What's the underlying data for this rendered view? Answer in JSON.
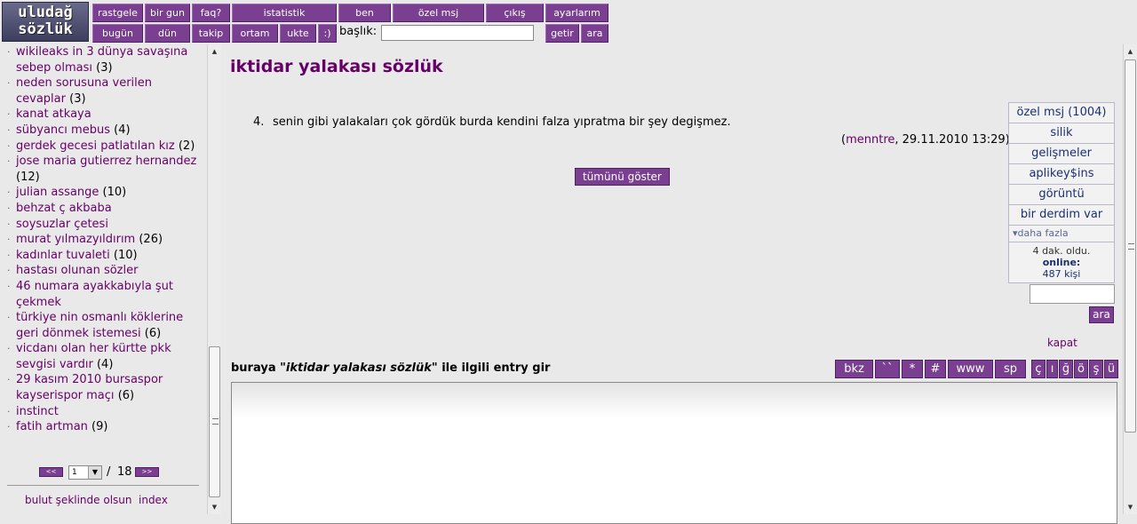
{
  "logo": {
    "line1": "uludağ",
    "line2": "sözlük"
  },
  "nav": {
    "row1": [
      "rastgele",
      "bir gun",
      "faq?",
      "istatistik",
      "ben",
      "özel msj",
      "çıkış",
      "ayarlarım"
    ],
    "row2": [
      "bugün",
      "dün",
      "takip",
      "ortam",
      "ukte",
      ":)"
    ],
    "baslik_label": "başlık:",
    "baslik_value": "",
    "getir": "getir",
    "ara": "ara"
  },
  "sidebar": {
    "topics": [
      {
        "title": "wikileaks in 3 dünya savaşına sebep olması",
        "count": "(3)"
      },
      {
        "title": "neden sorusuna verilen cevaplar",
        "count": "(3)"
      },
      {
        "title": "kanat atkaya",
        "count": ""
      },
      {
        "title": "sübyancı mebus",
        "count": "(4)"
      },
      {
        "title": "gerdek gecesi patlatılan kız",
        "count": "(2)"
      },
      {
        "title": "jose maria gutierrez hernandez",
        "count": "(12)"
      },
      {
        "title": "julian assange",
        "count": "(10)"
      },
      {
        "title": "behzat ç akbaba",
        "count": ""
      },
      {
        "title": "soysuzlar çetesi",
        "count": ""
      },
      {
        "title": "murat yılmazyıldırım",
        "count": "(26)"
      },
      {
        "title": "kadınlar tuvaleti",
        "count": "(10)"
      },
      {
        "title": "hastası olunan sözler",
        "count": ""
      },
      {
        "title": "46 numara ayakkabıyla şut çekmek",
        "count": ""
      },
      {
        "title": "türkiye nin osmanlı köklerine geri dönmek istemesi",
        "count": "(6)"
      },
      {
        "title": "vicdanı olan her kürtte pkk sevgisi vardır",
        "count": "(4)"
      },
      {
        "title": "29 kasım 2010 bursaspor kayserispor maçı",
        "count": "(6)"
      },
      {
        "title": "instinct",
        "count": ""
      },
      {
        "title": "fatih artman",
        "count": "(9)"
      }
    ],
    "pager": {
      "prev": "<<",
      "page": "1",
      "slash": "/",
      "total": "18",
      "next": ">>"
    },
    "bulut": "bulut şeklinde olsun",
    "index": "index"
  },
  "main": {
    "title": "iktidar yalakası sözlük",
    "entry": {
      "number": "4.",
      "text": "senin gibi yalakaları çok gördük burda kendini falza yıpratma bir şey degişmez.",
      "meta_open": "(",
      "author": "menntre",
      "meta_rest": ", 29.11.2010 13:29)"
    },
    "show_all": "tümünü göster",
    "entry_prompt_prefix": "buraya ",
    "entry_prompt_title": "\"iktidar yalakası sözlük\"",
    "entry_prompt_suffix": " ile ilgili entry gir",
    "toolbar": [
      "bkz",
      "``",
      "*",
      "#",
      "www",
      "sp"
    ],
    "chars": [
      "ç",
      "ı",
      "ğ",
      "ö",
      "ş",
      "ü"
    ]
  },
  "right_menu": {
    "items": [
      "özel msj (1004)",
      "silik",
      "gelişmeler",
      "aplikey$ins",
      "görüntü",
      "bir derdim var"
    ],
    "more": "daha fazla",
    "status_line": "4 dak. oldu.",
    "online_label": "online:",
    "online_count": "487 kişi",
    "search_value": "",
    "ara": "ara",
    "kapat": "kapat"
  },
  "colors": {
    "accent": "#7b3f92",
    "link": "#660066",
    "menu_text": "#1a3070",
    "background": "#e9e9e9"
  }
}
